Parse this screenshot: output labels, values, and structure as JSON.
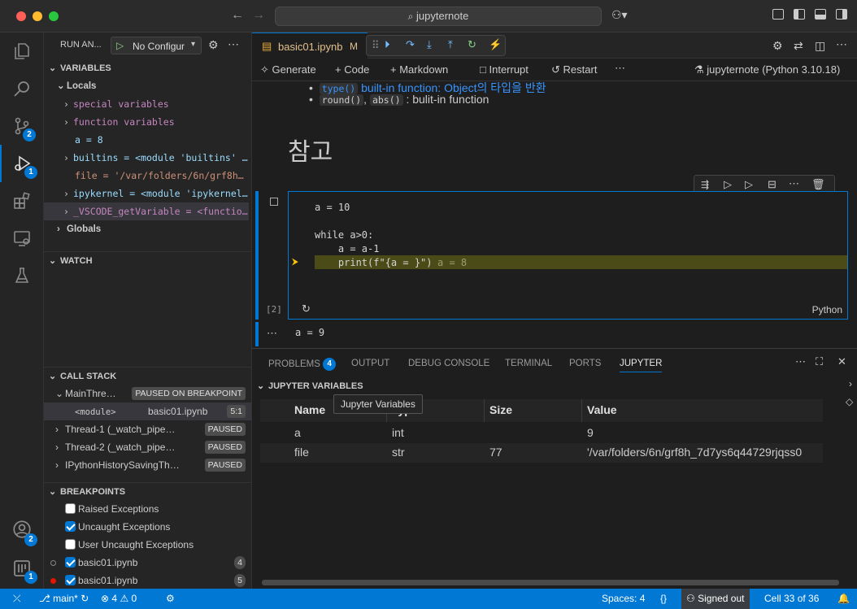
{
  "window": {
    "search": "jupyternote"
  },
  "activity": {
    "scm_badge": "2",
    "debug_badge": "1",
    "account_badge": "2",
    "remote_badge": "1"
  },
  "run": {
    "label": "RUN AN...",
    "config": "No Configur"
  },
  "variables": {
    "header": "VARIABLES",
    "locals": "Locals",
    "items": [
      {
        "text": "special variables"
      },
      {
        "text": "function variables"
      },
      {
        "text": "a = 8"
      },
      {
        "text": "builtins = <module 'builtins' (…"
      },
      {
        "text": "file = '/var/folders/6n/grf8h_7…"
      },
      {
        "text": "ipykernel = <module 'ipykernel'…"
      },
      {
        "text": "_VSCODE_getVariable = <function…"
      }
    ],
    "globals": "Globals"
  },
  "watch": {
    "header": "WATCH"
  },
  "callstack": {
    "header": "CALL STACK",
    "main": "MainThre…",
    "main_status": "PAUSED ON BREAKPOINT",
    "frame": "<module>",
    "frame_file": "basic01.ipynb",
    "frame_pos": "5:1",
    "threads": [
      {
        "name": "Thread-1 (_watch_pipe…",
        "status": "PAUSED"
      },
      {
        "name": "Thread-2 (_watch_pipe…",
        "status": "PAUSED"
      },
      {
        "name": "IPythonHistorySavingTh…",
        "status": "PAUSED"
      }
    ]
  },
  "breakpoints": {
    "header": "BREAKPOINTS",
    "items": [
      {
        "label": "Raised Exceptions",
        "checked": false
      },
      {
        "label": "Uncaught Exceptions",
        "checked": true
      },
      {
        "label": "User Uncaught Exceptions",
        "checked": false
      },
      {
        "label": "basic01.ipynb",
        "checked": true,
        "count": "4"
      },
      {
        "label": "basic01.ipynb",
        "checked": true,
        "count": "5"
      }
    ]
  },
  "editor": {
    "tab": "basic01.ipynb",
    "tab_flag": "M",
    "toolbar": {
      "generate": "Generate",
      "code": "Code",
      "markdown": "Markdown",
      "interrupt": "Interrupt",
      "restart": "Restart",
      "kernel": "jupyternote (Python 3.10.18)"
    },
    "md": {
      "line1_code": "type()",
      "line1_text": " built-in function: Object의 타입을 반환",
      "line2_code1": "round()",
      "line2_sep": ", ",
      "line2_code2": "abs()",
      "line2_text": " : bulit-in function",
      "heading": "참고"
    },
    "cell": {
      "lines": [
        "a = 10",
        "",
        "while a>0:",
        "    a = a-1"
      ],
      "print_line": "    print(f\"{a = }\")",
      "inline_value": "a = 8",
      "exec_count": "[2]",
      "lang": "Python",
      "output": "a = 9"
    }
  },
  "panel": {
    "tabs": [
      "PROBLEMS",
      "OUTPUT",
      "DEBUG CONSOLE",
      "TERMINAL",
      "PORTS",
      "JUPYTER"
    ],
    "problems_count": "4",
    "section": "JUPYTER VARIABLES",
    "tooltip": "Jupyter Variables",
    "columns": [
      "Name",
      "Type",
      "Size",
      "Value"
    ],
    "rows": [
      {
        "name": "a",
        "type": "int",
        "size": "",
        "value": "9"
      },
      {
        "name": "file",
        "type": "str",
        "size": "77",
        "value": "'/var/folders/6n/grf8h_7d7ys6q44729rjqss0"
      }
    ]
  },
  "status": {
    "branch": "main*",
    "errors": "4",
    "warnings": "0",
    "spaces": "Spaces: 4",
    "braces": "{}",
    "signed": "Signed out",
    "cell": "Cell 33 of 36"
  },
  "colors": {
    "accent": "#0078d4",
    "breakpoint": "#e51400",
    "highlight": "#4b4b18"
  }
}
